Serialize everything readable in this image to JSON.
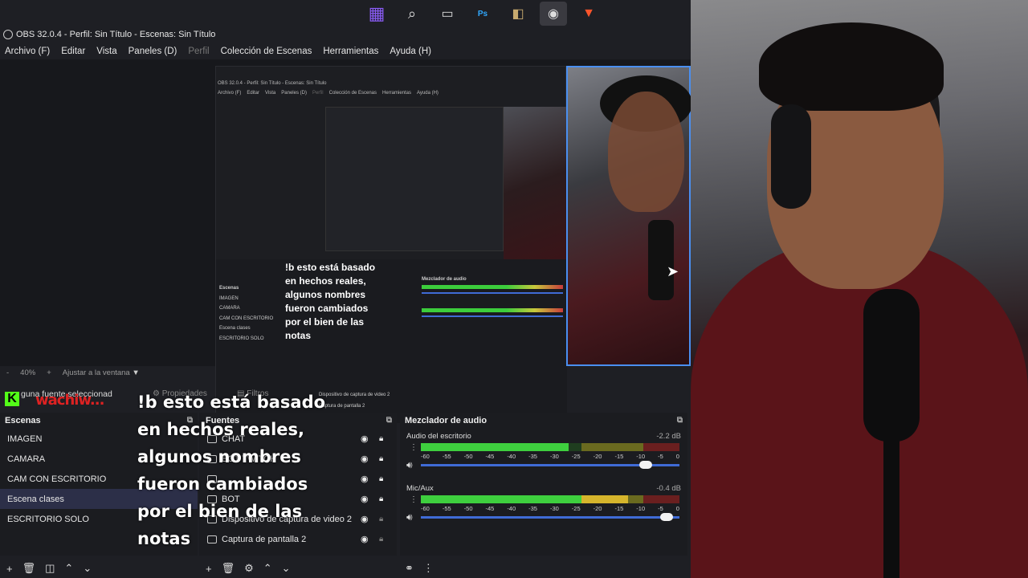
{
  "taskbar": {
    "icons": [
      "windows-icon",
      "search-icon",
      "taskview-icon",
      "photoshop-icon",
      "league-icon",
      "obs-icon",
      "brave-icon"
    ],
    "ps_label": "Ps"
  },
  "window": {
    "title": "OBS 32.0.4 - Perfil: Sin Título - Escenas: Sin Título"
  },
  "menu": {
    "items": [
      "Archivo (F)",
      "Editar",
      "Vista",
      "Paneles (D)",
      "Perfil",
      "Colección de Escenas",
      "Herramientas",
      "Ayuda (H)"
    ]
  },
  "nested": {
    "title": "OBS 32.0.4 - Perfil: Sin Título - Escenas: Sin Título",
    "menu": [
      "Archivo (F)",
      "Editar",
      "Vista",
      "Paneles (D)",
      "Perfil",
      "Colección de Escenas",
      "Herramientas",
      "Ayuda (H)"
    ],
    "overlay_lines": [
      "!b esto está basado",
      "en hechos reales,",
      "algunos nombres",
      "fueron cambiados",
      "por el bien de las",
      "notas"
    ],
    "scenes_label": "Escenas",
    "scenes": [
      "IMAGEN",
      "CAMARA",
      "CAM CON ESCRITORIO",
      "Escena clases",
      "ESCRITORIO SOLO"
    ],
    "mixer_label": "Mezclador de audio",
    "source_a": "Dispositivo de captura de video 2",
    "source_b": "Captura de pantalla 2"
  },
  "zoom": {
    "minus": "-",
    "value": "40%",
    "plus": "+",
    "fit": "Ajustar a la ventana"
  },
  "header_strip": {
    "no_source": "guna fuente seleccionad",
    "properties": "Propiedades",
    "filters": "Filtros",
    "watermark": "wachiw..."
  },
  "overlay": {
    "lines": [
      "!b esto está basado",
      "en hechos reales,",
      "algunos nombres",
      "fueron cambiados",
      "por el bien de las",
      "notas"
    ]
  },
  "scenes": {
    "title": "Escenas",
    "items": [
      "IMAGEN",
      "CAMARA",
      "CAM CON ESCRITORIO",
      "Escena clases",
      "ESCRITORIO SOLO"
    ],
    "selected": "Escena clases"
  },
  "sources": {
    "title": "Fuentes",
    "items": [
      "CHAT",
      "BOT TWITCH",
      "",
      "BOT",
      "Dispositivo de captura de video 2",
      "Captura de pantalla 2"
    ]
  },
  "mixer": {
    "title": "Mezclador de audio",
    "ticks": [
      "-60",
      "-55",
      "-50",
      "-45",
      "-40",
      "-35",
      "-30",
      "-25",
      "-20",
      "-15",
      "-10",
      "-5",
      "0"
    ],
    "channels": [
      {
        "name": "Audio del escritorio",
        "db": "-2.2 dB",
        "level": 0.57,
        "volume": 0.87
      },
      {
        "name": "Mic/Aux",
        "db": "-0.4 dB",
        "level": 0.8,
        "volume": 0.95
      }
    ]
  },
  "colors": {
    "accent": "#3f6bd6",
    "meter_green": "#3ecf3e",
    "selection": "#2c2f48",
    "kick_green": "#53fc18"
  }
}
